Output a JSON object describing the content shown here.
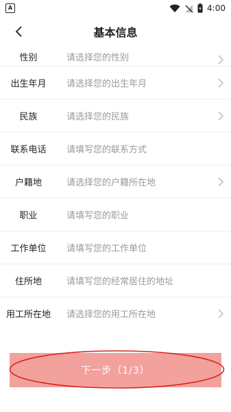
{
  "status_bar": {
    "time": "4:00",
    "left_badge": "A",
    "icons": [
      "wifi-icon",
      "signal-off-icon",
      "battery-icon"
    ]
  },
  "header": {
    "title": "基本信息",
    "back_icon": "chevron-left-icon"
  },
  "form": {
    "rows": [
      {
        "label": "性别",
        "placeholder": "请选择您的性别",
        "has_chevron": true
      },
      {
        "label": "出生年月",
        "placeholder": "请选择您的出生年月",
        "has_chevron": true
      },
      {
        "label": "民族",
        "placeholder": "请选择您的民族",
        "has_chevron": true
      },
      {
        "label": "联系电话",
        "placeholder": "请填写您的联系方式",
        "has_chevron": false
      },
      {
        "label": "户籍地",
        "placeholder": "请选择您的户籍所在地",
        "has_chevron": true
      },
      {
        "label": "职业",
        "placeholder": "请填写您的职业",
        "has_chevron": false
      },
      {
        "label": "工作单位",
        "placeholder": "请填写您的工作单位",
        "has_chevron": false
      },
      {
        "label": "住所地",
        "placeholder": "请填写您的经常居住的地址",
        "has_chevron": false
      },
      {
        "label": "用工所在地",
        "placeholder": "请选择您的用工所在地",
        "has_chevron": true
      }
    ]
  },
  "next_button": {
    "label": "下一步（1/3）"
  },
  "colors": {
    "button_bg": "#f2a19c",
    "annotation": "#d8231e",
    "placeholder": "#9a9a9a",
    "divider": "#ededed"
  }
}
